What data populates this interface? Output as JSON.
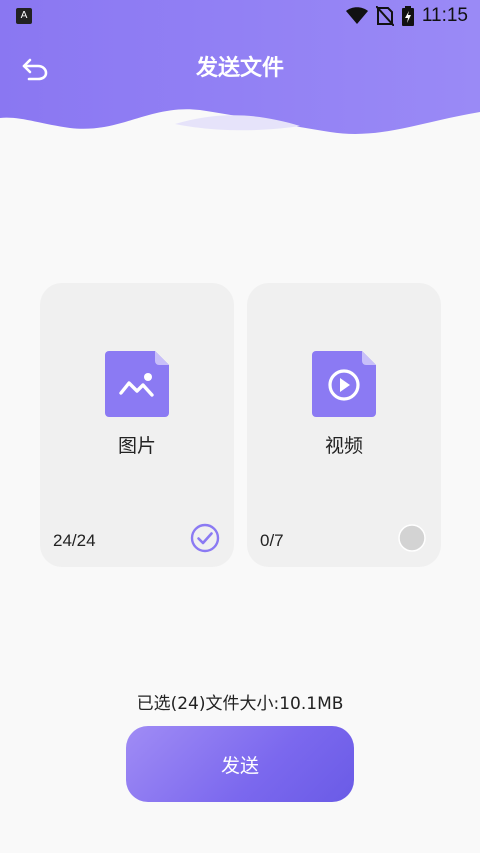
{
  "status_bar": {
    "app_icon_letter": "A",
    "time": "11:15",
    "icons": [
      "wifi-icon",
      "no-sim-icon",
      "battery-charging-icon"
    ]
  },
  "header": {
    "title": "发送文件",
    "back_icon": "undo-arrow-icon",
    "gradient": [
      "#8d7bf0",
      "#7d6cf0"
    ]
  },
  "categories": [
    {
      "label": "图片",
      "count": "24/24",
      "selected": true,
      "icon": "image-file-icon"
    },
    {
      "label": "视频",
      "count": "0/7",
      "selected": false,
      "icon": "video-file-icon"
    }
  ],
  "summary": "已选(24)文件大小:10.1MB",
  "send_button": {
    "label": "发送"
  },
  "colors": {
    "accent": "#8b7af3",
    "card_bg": "#f0f0f0",
    "page_bg": "#f9f9f9",
    "unselected_circle": "#d3d3d3"
  }
}
